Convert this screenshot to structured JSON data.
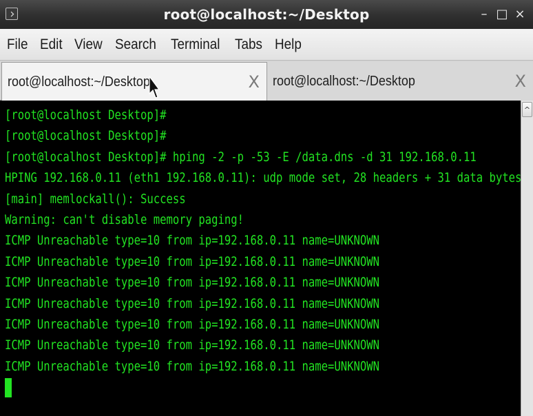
{
  "window": {
    "title": "root@localhost:~/Desktop",
    "controls": {
      "minimize": "–",
      "maximize": "□",
      "close": "×"
    }
  },
  "menubar": {
    "items": [
      {
        "label": "File"
      },
      {
        "label": "Edit"
      },
      {
        "label": "View"
      },
      {
        "label": "Search"
      },
      {
        "label": "Terminal"
      },
      {
        "label": "Tabs"
      },
      {
        "label": "Help"
      }
    ]
  },
  "tabs": [
    {
      "label": "root@localhost:~/Desktop",
      "close": "X",
      "active": true
    },
    {
      "label": "root@localhost:~/Desktop",
      "close": "X",
      "active": false
    }
  ],
  "terminal": {
    "lines": [
      "[root@localhost Desktop]#",
      "[root@localhost Desktop]#",
      "[root@localhost Desktop]# hping -2 -p -53 -E /data.dns -d 31 192.168.0.11",
      "HPING 192.168.0.11 (eth1 192.168.0.11): udp mode set, 28 headers + 31 data bytes",
      "[main] memlockall(): Success",
      "Warning: can't disable memory paging!",
      "ICMP Unreachable type=10 from ip=192.168.0.11 name=UNKNOWN",
      "ICMP Unreachable type=10 from ip=192.168.0.11 name=UNKNOWN",
      "ICMP Unreachable type=10 from ip=192.168.0.11 name=UNKNOWN",
      "ICMP Unreachable type=10 from ip=192.168.0.11 name=UNKNOWN",
      "ICMP Unreachable type=10 from ip=192.168.0.11 name=UNKNOWN",
      "ICMP Unreachable type=10 from ip=192.168.0.11 name=UNKNOWN",
      "ICMP Unreachable type=10 from ip=192.168.0.11 name=UNKNOWN"
    ],
    "text_color": "#22e322",
    "background": "#000000"
  },
  "scrollbar": {
    "up_arrow": "^"
  },
  "icons": {
    "window_menu": "window-menu-icon",
    "mouse_pointer": "mouse-pointer-icon",
    "tab_close": "close-icon"
  }
}
